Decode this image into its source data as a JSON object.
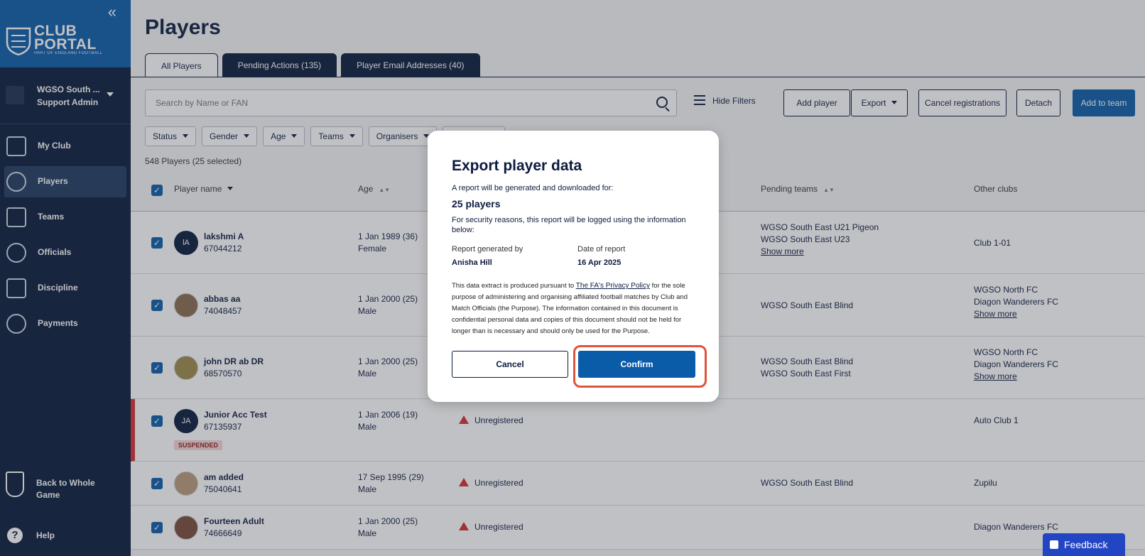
{
  "sidebar": {
    "collapse": "«",
    "brand_title_1": "CLUB",
    "brand_title_2": "PORTAL",
    "brand_sub": "PART OF ENGLAND FOOTBALL",
    "club_name": "WGSO South ...",
    "club_role": "Support Admin",
    "items": [
      {
        "label": "My Club"
      },
      {
        "label": "Players"
      },
      {
        "label": "Teams"
      },
      {
        "label": "Officials"
      },
      {
        "label": "Discipline"
      },
      {
        "label": "Payments"
      }
    ],
    "back_label": "Back to Whole Game",
    "help_label": "Help"
  },
  "page": {
    "title": "Players",
    "tabs": [
      "All Players",
      "Pending Actions (135)",
      "Player Email Addresses (40)"
    ],
    "search_placeholder": "Search by Name or FAN",
    "hide_filters": "Hide Filters",
    "buttons": {
      "add_player": "Add player",
      "export": "Export",
      "cancel_registrations": "Cancel registrations",
      "detach": "Detach",
      "add_to_team": "Add to team"
    },
    "filters": [
      "Status",
      "Gender",
      "Age",
      "Teams",
      "Organisers"
    ],
    "count_text": "548 Players (25 selected)",
    "columns": {
      "player_name": "Player name",
      "age": "Age",
      "pending_teams": "Pending teams",
      "other_clubs": "Other clubs"
    }
  },
  "rows": [
    {
      "initials": "lA",
      "name": "lakshmi A",
      "fan": "67044212",
      "dob": "1 Jan 1989 (36)",
      "gender": "Female",
      "status": "",
      "pending": [
        "WGSO South East U21 Pigeon",
        "WGSO South East U23"
      ],
      "pending_more": "Show more",
      "clubs": [
        "Club 1-01"
      ],
      "clubs_more": ""
    },
    {
      "initials": "",
      "name": "abbas aa",
      "fan": "74048457",
      "dob": "1 Jan 2000 (25)",
      "gender": "Male",
      "status": "",
      "pending": [
        "WGSO South East Blind"
      ],
      "pending_more": "",
      "clubs": [
        "WGSO North FC",
        "Diagon Wanderers FC"
      ],
      "clubs_more": "Show more"
    },
    {
      "initials": "",
      "name": "john DR ab DR",
      "fan": "68570570",
      "dob": "1 Jan 2000 (25)",
      "gender": "Male",
      "status": "",
      "pending": [
        "WGSO South East Blind",
        "WGSO South East First"
      ],
      "pending_more": "",
      "clubs": [
        "WGSO North FC",
        "Diagon Wanderers FC"
      ],
      "clubs_more": "Show more"
    },
    {
      "initials": "JA",
      "name": "Junior Acc Test",
      "fan": "67135937",
      "dob": "1 Jan 2006 (19)",
      "gender": "Male",
      "status": "Unregistered",
      "badge": "SUSPENDED",
      "pending": [],
      "pending_more": "",
      "clubs": [
        "Auto Club 1"
      ],
      "clubs_more": ""
    },
    {
      "initials": "",
      "name": "am added",
      "fan": "75040641",
      "dob": "17 Sep 1995 (29)",
      "gender": "Male",
      "status": "Unregistered",
      "pending": [
        "WGSO South East Blind"
      ],
      "pending_more": "",
      "clubs": [
        "Zupilu"
      ],
      "clubs_more": ""
    },
    {
      "initials": "",
      "name": "Fourteen Adult",
      "fan": "74666649",
      "dob": "1 Jan 2000 (25)",
      "gender": "Male",
      "status": "Unregistered",
      "pending": [],
      "pending_more": "",
      "clubs": [
        "Diagon Wanderers FC"
      ],
      "clubs_more": ""
    }
  ],
  "modal": {
    "title": "Export player data",
    "line1": "A report will be generated and downloaded for:",
    "count": "25 players",
    "security": "For security reasons, this report will be logged using the information below:",
    "generated_by_label": "Report generated by",
    "generated_by": "Anisha Hill",
    "date_label": "Date of report",
    "date": "16 Apr 2025",
    "legal_pre": "This data extract is produced pursuant to ",
    "legal_link": "The FA's Privacy Policy",
    "legal_post": " for the sole purpose of administering and organising affiliated football matches by Club and Match Officials (the Purpose). The information contained in this document is confidential personal data and copies of this document should not be held for longer than is necessary and should only be used for the Purpose.",
    "cancel": "Cancel",
    "confirm": "Confirm"
  },
  "feedback": "Feedback",
  "colors": {
    "navy": "#061a3a",
    "brand_blue": "#0a5ba8",
    "highlight": "#e0533d",
    "danger": "#d32f2f",
    "feedback": "#2245c4"
  }
}
